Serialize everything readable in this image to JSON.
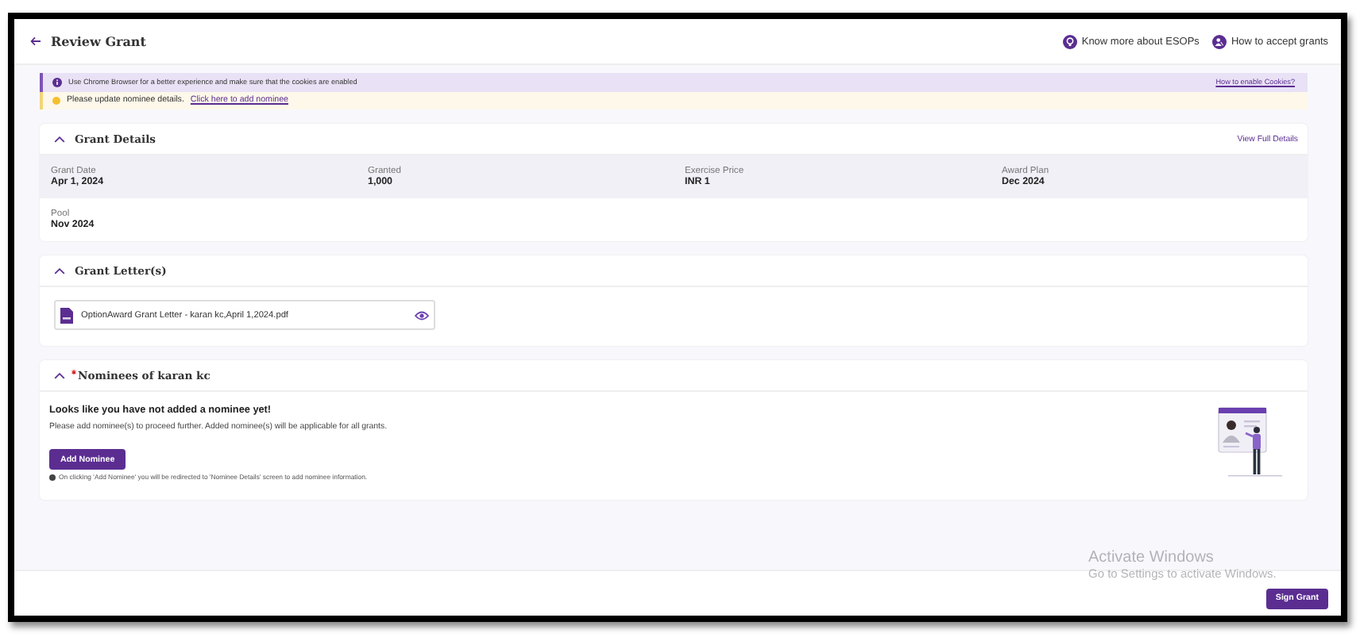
{
  "header": {
    "title": "Review Grant",
    "links": [
      {
        "kind": "bulb",
        "label": "Know more about ESOPs"
      },
      {
        "kind": "person",
        "label": "How to accept grants"
      }
    ]
  },
  "notices": [
    {
      "kind": "info",
      "text": "Use Chrome Browser for a better experience and make sure that the cookies are enabled",
      "link": "How to enable Cookies?"
    },
    {
      "kind": "warning",
      "text": "Please update nominee details.",
      "link": "Click here to add nominee"
    }
  ],
  "grant_details": {
    "title": "Grant Details",
    "expanded": true,
    "link": "View Full Details",
    "fields": [
      {
        "label": "Grant Date",
        "value": "Apr 1, 2024"
      },
      {
        "label": "Granted",
        "value": "1,000"
      },
      {
        "label": "Exercise Price",
        "value": "INR 1"
      },
      {
        "label": "Award Plan",
        "value": "Dec 2024"
      },
      {
        "label": "Pool",
        "value": "Nov 2024"
      }
    ]
  },
  "grant_letters": {
    "title": "Grant Letter(s)",
    "expanded": true,
    "files": [
      {
        "name": "OptionAward Grant Letter - karan kc,April 1,2024.pdf"
      }
    ]
  },
  "nominees": {
    "title": "Nominees of karan kc",
    "required": true,
    "expanded": true,
    "heading": "Looks like you have not added a nominee yet!",
    "message": "Please add nominee(s) to proceed further. Added nominee(s) will be applicable for all grants.",
    "button": "Add Nominee",
    "note": "On clicking 'Add Nominee' you will be redirected to 'Nominee Details' screen to add nominee information."
  },
  "os_overlay": {
    "title": "Activate Windows",
    "subtitle": "Go to Settings to activate Windows."
  },
  "footer": {
    "button": "Sign Grant"
  }
}
